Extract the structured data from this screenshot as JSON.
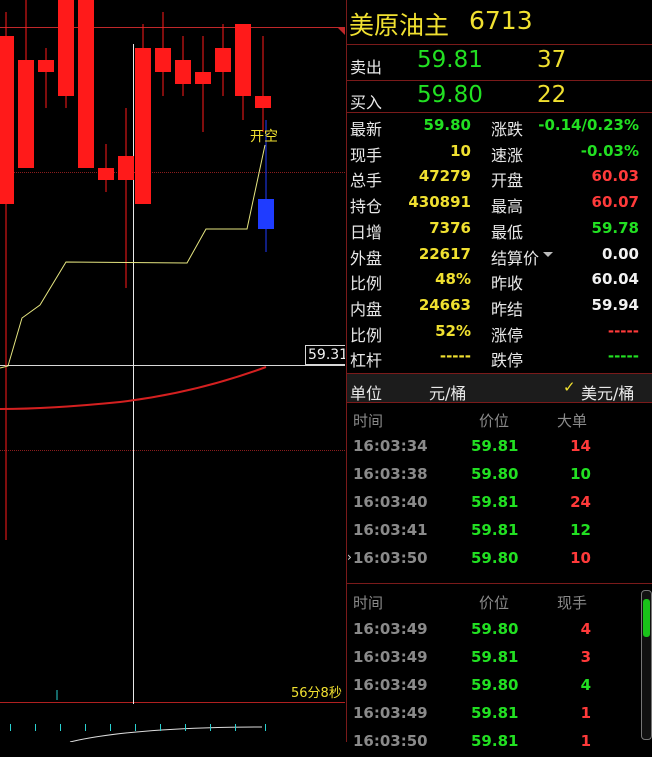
{
  "chart": {
    "annotation": "开空",
    "price_label": "59.31",
    "time_left": "56分8秒",
    "candles": [
      {
        "open": 60.32,
        "close": 60.18,
        "high": 60.34,
        "low": 59.9,
        "color": "red"
      },
      {
        "open": 60.21,
        "close": 60.3,
        "high": 60.48,
        "low": 60.21,
        "color": "red"
      },
      {
        "open": 60.29,
        "close": 60.3,
        "high": 60.31,
        "low": 60.26,
        "color": "red"
      },
      {
        "open": 60.27,
        "close": 60.35,
        "high": 60.39,
        "low": 60.26,
        "color": "red"
      },
      {
        "open": 60.35,
        "close": 60.21,
        "high": 60.35,
        "low": 60.21,
        "color": "red"
      },
      {
        "open": 60.21,
        "close": 60.2,
        "high": 60.23,
        "low": 60.19,
        "color": "red"
      },
      {
        "open": 60.2,
        "close": 60.22,
        "high": 60.26,
        "low": 60.11,
        "color": "red"
      },
      {
        "open": 60.18,
        "close": 60.31,
        "high": 60.33,
        "low": 60.18,
        "color": "red"
      },
      {
        "open": 60.31,
        "close": 60.29,
        "high": 60.34,
        "low": 60.27,
        "color": "red"
      },
      {
        "open": 60.3,
        "close": 60.28,
        "high": 60.32,
        "low": 60.27,
        "color": "red"
      },
      {
        "open": 60.28,
        "close": 60.29,
        "high": 60.32,
        "low": 60.24,
        "color": "red"
      },
      {
        "open": 60.29,
        "close": 60.31,
        "high": 60.33,
        "low": 60.27,
        "color": "red"
      },
      {
        "open": 60.33,
        "close": 60.27,
        "high": 60.33,
        "low": 60.25,
        "color": "red"
      },
      {
        "open": 60.27,
        "close": 60.26,
        "high": 60.32,
        "low": 60.24,
        "color": "red"
      },
      {
        "open": 60.25,
        "close": 60.14,
        "high": 60.25,
        "low": 60.14,
        "color": "blue"
      }
    ]
  },
  "panel": {
    "title": "美原油主",
    "code": "6713",
    "sell": {
      "label": "卖出",
      "price": "59.81",
      "qty": "37"
    },
    "buy": {
      "label": "买入",
      "price": "59.80",
      "qty": "22"
    },
    "stats": [
      {
        "l1": "最新",
        "v1": "59.80",
        "c1": "g",
        "l2": "涨跌",
        "v2": "-0.14/0.23%",
        "c2": "g"
      },
      {
        "l1": "现手",
        "v1": "10",
        "c1": "y",
        "l2": "速涨",
        "v2": "-0.03%",
        "c2": "g"
      },
      {
        "l1": "总手",
        "v1": "47279",
        "c1": "y",
        "l2": "开盘",
        "v2": "60.03",
        "c2": "r"
      },
      {
        "l1": "持仓",
        "v1": "430891",
        "c1": "y",
        "l2": "最高",
        "v2": "60.07",
        "c2": "r"
      },
      {
        "l1": "日增",
        "v1": "7376",
        "c1": "y",
        "l2": "最低",
        "v2": "59.78",
        "c2": "g"
      },
      {
        "l1": "外盘",
        "v1": "22617",
        "c1": "y",
        "l2": "结算价",
        "v2": "0.00",
        "c2": "w"
      },
      {
        "l1": "比例",
        "v1": "48%",
        "c1": "y",
        "l2": "昨收",
        "v2": "60.04",
        "c2": "w"
      },
      {
        "l1": "内盘",
        "v1": "24663",
        "c1": "y",
        "l2": "昨结",
        "v2": "59.94",
        "c2": "w"
      },
      {
        "l1": "比例",
        "v1": "52%",
        "c1": "y",
        "l2": "涨停",
        "v2": "-----",
        "c2": "r"
      },
      {
        "l1": "杠杆",
        "v1": "-----",
        "c1": "y",
        "l2": "跌停",
        "v2": "-----",
        "c2": "g"
      }
    ],
    "unit_label": "单位",
    "unit_value": "元/桶",
    "unit_option": "美元/桶",
    "big_orders": {
      "headers": [
        "时间",
        "价位",
        "大单"
      ],
      "rows": [
        {
          "time": "16:03:34",
          "price": "59.81",
          "qty": "14",
          "pc": "g",
          "qc": "r"
        },
        {
          "time": "16:03:38",
          "price": "59.80",
          "qty": "10",
          "pc": "g",
          "qc": "g"
        },
        {
          "time": "16:03:40",
          "price": "59.81",
          "qty": "24",
          "pc": "g",
          "qc": "r"
        },
        {
          "time": "16:03:41",
          "price": "59.81",
          "qty": "12",
          "pc": "g",
          "qc": "g"
        },
        {
          "time": "16:03:50",
          "price": "59.80",
          "qty": "10",
          "pc": "g",
          "qc": "r"
        }
      ]
    },
    "ticks": {
      "headers": [
        "时间",
        "价位",
        "现手"
      ],
      "rows": [
        {
          "time": "16:03:49",
          "price": "59.80",
          "qty": "4",
          "pc": "g",
          "qc": "r"
        },
        {
          "time": "16:03:49",
          "price": "59.81",
          "qty": "3",
          "pc": "g",
          "qc": "r"
        },
        {
          "time": "16:03:49",
          "price": "59.80",
          "qty": "4",
          "pc": "g",
          "qc": "g"
        },
        {
          "time": "16:03:49",
          "price": "59.81",
          "qty": "1",
          "pc": "g",
          "qc": "r"
        },
        {
          "time": "16:03:50",
          "price": "59.81",
          "qty": "1",
          "pc": "g",
          "qc": "r"
        }
      ]
    }
  }
}
